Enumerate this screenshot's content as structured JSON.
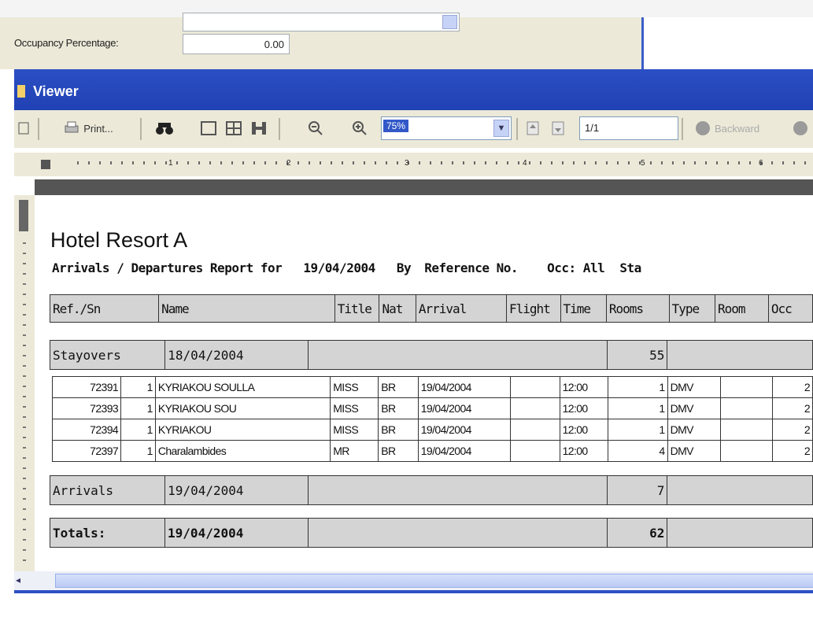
{
  "form": {
    "occupancy_label": "Occupancy Percentage:",
    "occupancy_value": "0.00"
  },
  "window": {
    "title": "Viewer"
  },
  "toolbar": {
    "print_label": "Print...",
    "zoom_value": "75%",
    "page_value": "1/1",
    "backward_label": "Backward"
  },
  "ruler": {
    "marks": [
      "1",
      "2",
      "3",
      "4",
      "5",
      "6"
    ]
  },
  "report": {
    "title": "Hotel Resort A",
    "subtitle": "Arrivals / Departures Report for",
    "date": "19/04/2004",
    "by_label": "By",
    "by_value": "Reference No.",
    "occ_label": "Occ: All",
    "status_label": "Sta",
    "columns": [
      "Ref./Sn",
      "Name",
      "Title",
      "Nat",
      "Arrival",
      "Flight",
      "Time",
      "Rooms",
      "Type",
      "Room",
      "Occ"
    ],
    "stayovers": {
      "label": "Stayovers",
      "date": "18/04/2004",
      "rooms": "55"
    },
    "rows": [
      {
        "ref": "72391",
        "sn": "1",
        "name": "KYRIAKOU SOULLA",
        "title": "MISS",
        "nat": "BR",
        "arrival": "19/04/2004",
        "flight": "",
        "time": "12:00",
        "rooms": "1",
        "type": "DMV",
        "room": "",
        "occ": "2"
      },
      {
        "ref": "72393",
        "sn": "1",
        "name": "KYRIAKOU SOU",
        "title": "MISS",
        "nat": "BR",
        "arrival": "19/04/2004",
        "flight": "",
        "time": "12:00",
        "rooms": "1",
        "type": "DMV",
        "room": "",
        "occ": "2"
      },
      {
        "ref": "72394",
        "sn": "1",
        "name": "KYRIAKOU",
        "title": "MISS",
        "nat": "BR",
        "arrival": "19/04/2004",
        "flight": "",
        "time": "12:00",
        "rooms": "1",
        "type": "DMV",
        "room": "",
        "occ": "2"
      },
      {
        "ref": "72397",
        "sn": "1",
        "name": "Charalambides",
        "title": "MR",
        "nat": "BR",
        "arrival": "19/04/2004",
        "flight": "",
        "time": "12:00",
        "rooms": "4",
        "type": "DMV",
        "room": "",
        "occ": "2"
      }
    ],
    "arrivals": {
      "label": "Arrivals",
      "date": "19/04/2004",
      "rooms": "7"
    },
    "totals": {
      "label": "Totals:",
      "date": "19/04/2004",
      "rooms": "62"
    }
  }
}
